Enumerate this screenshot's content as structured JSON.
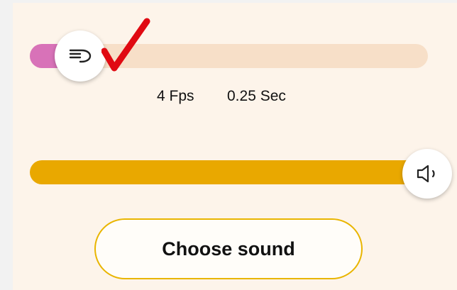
{
  "speed_slider": {
    "value_fraction": 0.11,
    "fill_color": "#d872b8",
    "track_color": "#f7dfc8",
    "thumb_icon": "speed-lines-icon"
  },
  "checkmark": {
    "icon": "checkmark-icon",
    "color": "#e00a12"
  },
  "readout": {
    "fps": "4 Fps",
    "seconds": "0.25 Sec"
  },
  "volume_slider": {
    "value_fraction": 1.0,
    "track_color": "#e9a800",
    "thumb_icon": "speaker-icon"
  },
  "choose_sound_button": {
    "label": "Choose sound",
    "border_color": "#e9b500"
  }
}
